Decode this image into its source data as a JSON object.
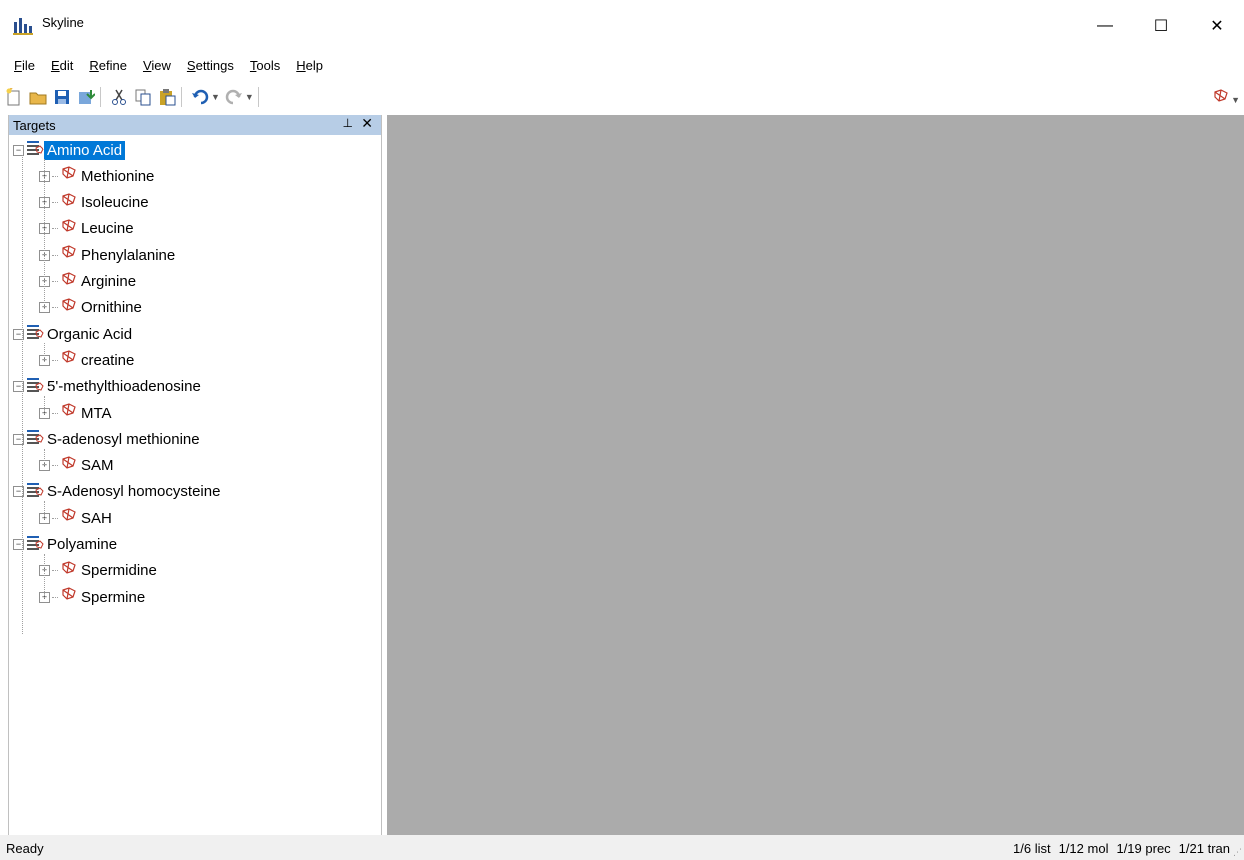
{
  "window": {
    "title": "Skyline",
    "minimize_glyph": "—",
    "maximize_glyph": "☐",
    "close_glyph": "✕"
  },
  "menu": [
    {
      "label": "File",
      "mnemonic": "F"
    },
    {
      "label": "Edit",
      "mnemonic": "E"
    },
    {
      "label": "Refine",
      "mnemonic": "R"
    },
    {
      "label": "View",
      "mnemonic": "V"
    },
    {
      "label": "Settings",
      "mnemonic": "S"
    },
    {
      "label": "Tools",
      "mnemonic": "T"
    },
    {
      "label": "Help",
      "mnemonic": "H"
    }
  ],
  "toolbar": {
    "icons": [
      "new-document-icon",
      "open-folder-icon",
      "save-icon",
      "import-icon",
      "cut-icon",
      "copy-icon",
      "paste-icon",
      "undo-icon",
      "redo-icon",
      "molecule-mode-icon"
    ],
    "colors": {
      "accent": "#c0392b",
      "blue": "#1f5fb3",
      "yellow": "#e8b64a"
    }
  },
  "panel": {
    "title": "Targets",
    "pin_glyph": "⊥",
    "close_glyph": "✕",
    "header_color": "#b7cde6"
  },
  "tree": [
    {
      "label": "Amino Acid",
      "selected": true,
      "children": [
        "Methionine",
        "Isoleucine",
        "Leucine",
        "Phenylalanine",
        "Arginine",
        "Ornithine"
      ]
    },
    {
      "label": "Organic Acid",
      "selected": false,
      "children": [
        "creatine"
      ]
    },
    {
      "label": "5'-methylthioadenosine",
      "selected": false,
      "children": [
        "MTA"
      ]
    },
    {
      "label": "S-adenosyl methionine",
      "selected": false,
      "children": [
        "SAM"
      ]
    },
    {
      "label": "S-Adenosyl homocysteine",
      "selected": false,
      "children": [
        "SAH"
      ]
    },
    {
      "label": "Polyamine",
      "selected": false,
      "children": [
        "Spermidine",
        "Spermine"
      ]
    }
  ],
  "status": {
    "left": "Ready",
    "list": "1/6 list",
    "mol": "1/12 mol",
    "prec": "1/19 prec",
    "tran": "1/21 tran"
  }
}
